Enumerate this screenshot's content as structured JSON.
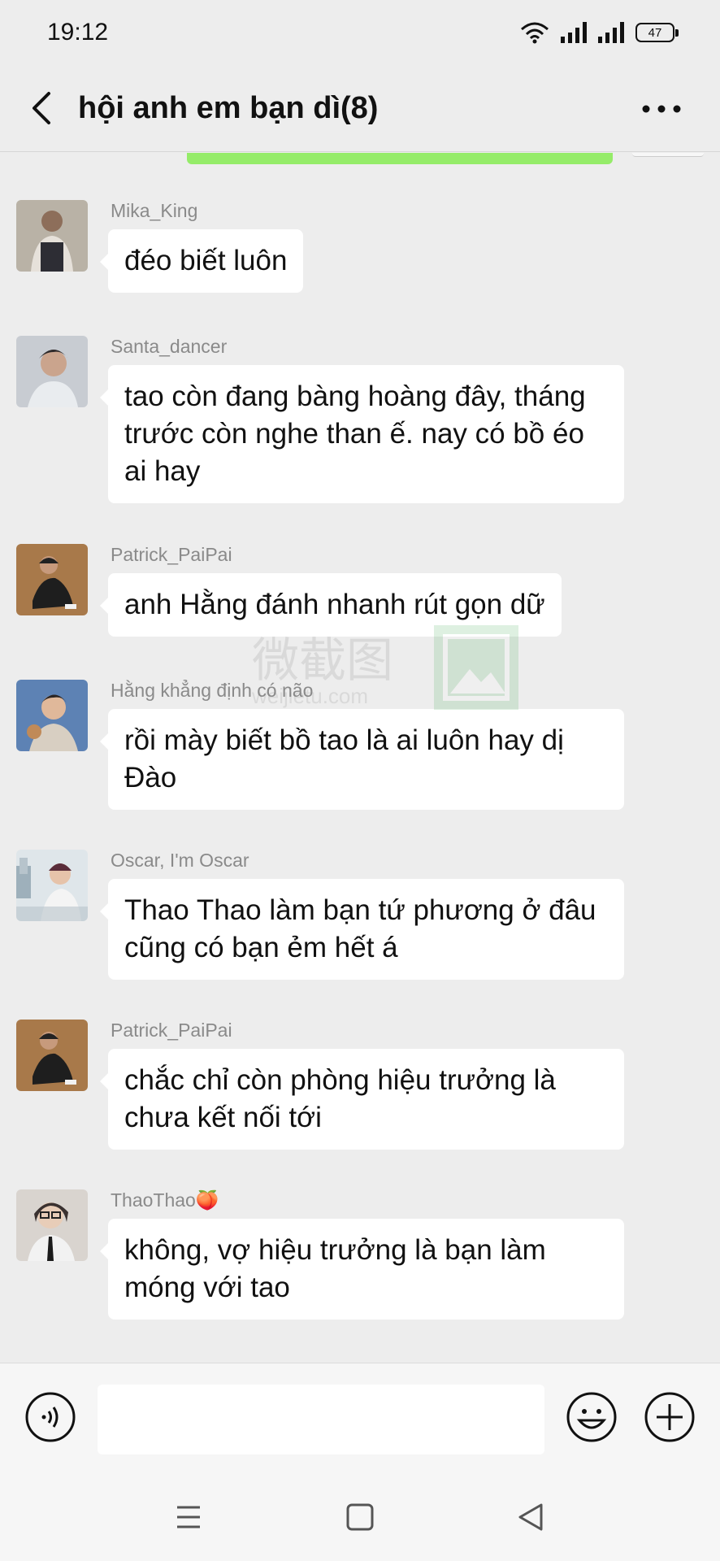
{
  "status_bar": {
    "time": "19:12",
    "battery": "47"
  },
  "header": {
    "title": "hội anh em bạn dì(8)"
  },
  "watermark": {
    "cjk": "微截图",
    "domain": "weijietu.com"
  },
  "messages": [
    {
      "sender": "Mika_King",
      "text": "đéo biết luôn"
    },
    {
      "sender": "Santa_dancer",
      "text": "tao còn đang bàng hoàng đây, tháng trước còn nghe than ế. nay có bồ éo ai hay"
    },
    {
      "sender": "Patrick_PaiPai",
      "text": "anh Hằng đánh nhanh rút gọn dữ"
    },
    {
      "sender": "Hằng khẳng định có não",
      "text": "rồi mày biết bồ tao là ai luôn hay dị Đào"
    },
    {
      "sender": "Oscar, I'm Oscar",
      "text": "Thao Thao làm bạn tứ phương ở đâu cũng có bạn ẻm hết á"
    },
    {
      "sender": "Patrick_PaiPai",
      "text": "chắc chỉ còn phòng hiệu trưởng là chưa kết nối tới"
    },
    {
      "sender": "ThaoThao🍑",
      "text": "không, vợ hiệu trưởng là bạn làm móng với tao"
    }
  ],
  "input": {
    "value": ""
  }
}
